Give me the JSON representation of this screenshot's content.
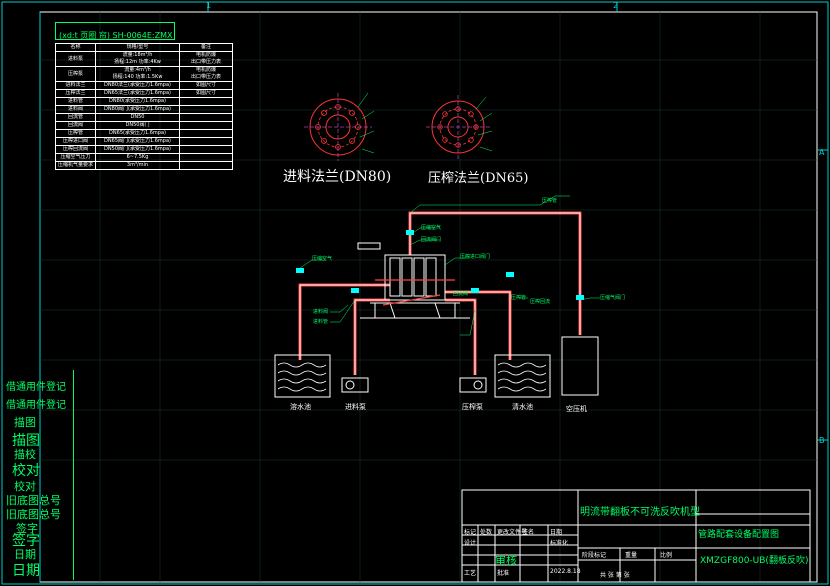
{
  "frame": {
    "top_markers": [
      "1",
      "2"
    ],
    "right_markers": [
      "A",
      "B"
    ]
  },
  "table_title": "(xd:t 页圈 帘) SH-0064E:ZMX",
  "spec_table": {
    "header": [
      "名称",
      "规格/型号",
      "备注"
    ],
    "rows": [
      [
        "进料泵",
        "流量:18m³/h\n扬程:12m 功率:4Kw",
        "电机防爆\n出口带压力表"
      ],
      [
        "压榨泵",
        "流量:4m³/h\n扬程:140 功率:1.5Kw",
        "电机防爆\n出口带压力表"
      ],
      [
        "进料法兰",
        "DN80法兰(承受压力1.6mpa)",
        "如图尺寸"
      ],
      [
        "压榨法兰",
        "DN65法兰(承受压力1.6mpa)",
        "如图尺寸"
      ],
      [
        "进料管",
        "DN80(承受压力1.6mpa)",
        ""
      ],
      [
        "进料阀",
        "DN80阀门(承受压力1.6mpa)",
        ""
      ],
      [
        "回流管",
        "DN50",
        ""
      ],
      [
        "回流阀",
        "DN50阀门",
        ""
      ],
      [
        "压榨管",
        "DN65(承受压力1.6mpa)",
        ""
      ],
      [
        "压榨进口阀",
        "DN65阀门(承受压力1.6mpa)",
        ""
      ],
      [
        "压榨回流阀",
        "DN50阀门(承受压力1.6mpa)",
        ""
      ],
      [
        "压缩空气压力",
        "6~7.5Kg",
        ""
      ],
      [
        "压缩机气量要求",
        "3m³/min",
        ""
      ]
    ]
  },
  "flanges": [
    {
      "name": "feed-flange",
      "label": "进料法兰(DN80)"
    },
    {
      "name": "press-flange",
      "label": "压榨法兰(DN65)"
    }
  ],
  "equipment_labels": {
    "slurry_pool": "溶水池",
    "feed_pump": "进料泵",
    "press_pump": "压榨泵",
    "water_tank": "清水池",
    "air_compressor": "空压机"
  },
  "pipe_annotations": [
    "压缩空气",
    "压榨管",
    "压缩空气",
    "回流阀门",
    "压榨进口阀门",
    "进料阀",
    "进料管",
    "回流阀",
    "压榨管",
    "压榨回流",
    "压缩气阀门"
  ],
  "side_panel": [
    "借通用件登记",
    "借通用件登记",
    "描图",
    "描图",
    "描校",
    "校对",
    "校对",
    "旧底图总号",
    "旧底图总号",
    "签字",
    "签字",
    "日期",
    "日期"
  ],
  "title_block": {
    "product_name": "明流带翻板不可洗反吹机型",
    "drawing_title": "管路配套设备配置图",
    "drawing_code": "XMZGF800-UB(翻板反吹)",
    "row_labels": [
      "标记",
      "处数",
      "更改文件号",
      "签名",
      "日期"
    ],
    "design": "设计",
    "standard": "标准化",
    "review": "审核",
    "process": "工艺",
    "approve": "批准",
    "stage_mark": "阶段标记",
    "weight": "重量",
    "scale": "比例",
    "date": "2022.8.18",
    "sheet": "共 张 第 张"
  }
}
